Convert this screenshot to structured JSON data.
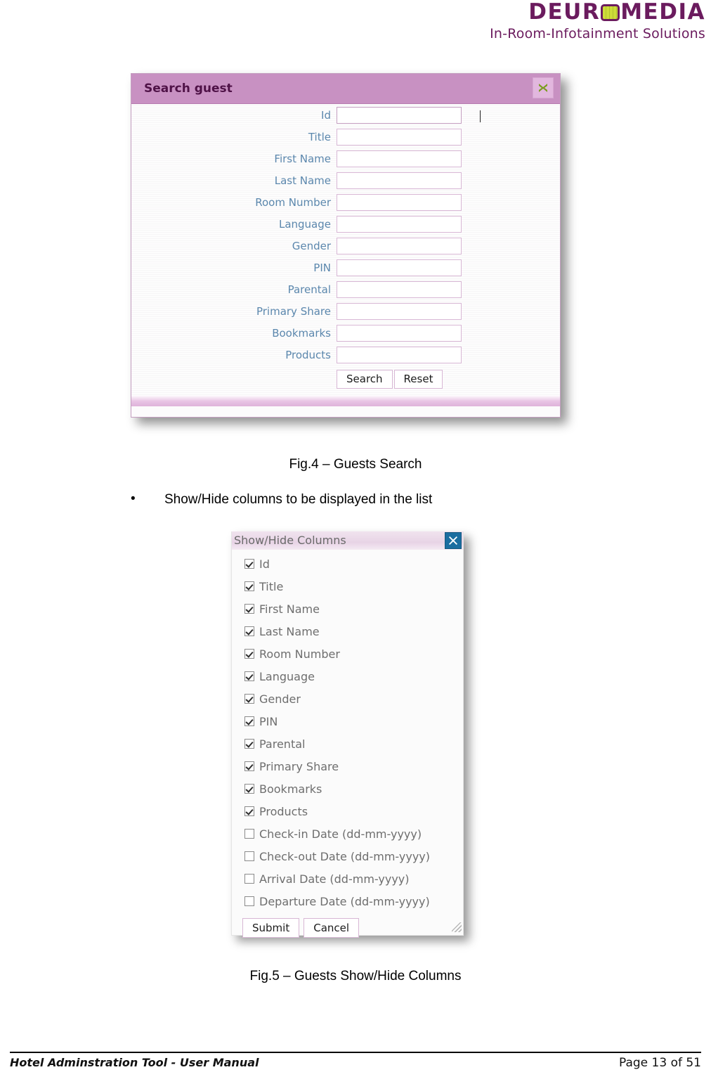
{
  "header": {
    "brand_name_before": "DEUR",
    "brand_icon": "grid-square-icon",
    "brand_name_after": "MEDIA",
    "tagline": "In-Room-Infotainment Solutions",
    "brand_color": "#6b1b5e",
    "icon_color": "#cddc39"
  },
  "search_dialog": {
    "title": "Search guest",
    "close_icon": "close-x-icon",
    "close_color": "#7a9c1d",
    "titlebar_color": "#c891c2",
    "fields": [
      {
        "label": "Id",
        "value": "",
        "focused": true
      },
      {
        "label": "Title",
        "value": "",
        "focused": false
      },
      {
        "label": "First Name",
        "value": "",
        "focused": false
      },
      {
        "label": "Last Name",
        "value": "",
        "focused": false
      },
      {
        "label": "Room Number",
        "value": "",
        "focused": false
      },
      {
        "label": "Language",
        "value": "",
        "focused": false
      },
      {
        "label": "Gender",
        "value": "",
        "focused": false
      },
      {
        "label": "PIN",
        "value": "",
        "focused": false
      },
      {
        "label": "Parental",
        "value": "",
        "focused": false
      },
      {
        "label": "Primary Share",
        "value": "",
        "focused": false
      },
      {
        "label": "Bookmarks",
        "value": "",
        "focused": false
      },
      {
        "label": "Products",
        "value": "",
        "focused": false
      }
    ],
    "search_button": "Search",
    "reset_button": "Reset"
  },
  "fig4_caption": "Fig.4 – Guests Search",
  "bullet_text": "Show/Hide columns to be displayed in the list",
  "bullet_marker": "•",
  "showhide_dialog": {
    "title": "Show/Hide Columns",
    "close_icon": "close-x-icon",
    "close_color": "#1b6ea0",
    "columns": [
      {
        "label": "Id",
        "checked": true
      },
      {
        "label": "Title",
        "checked": true
      },
      {
        "label": "First Name",
        "checked": true
      },
      {
        "label": "Last Name",
        "checked": true
      },
      {
        "label": "Room Number",
        "checked": true
      },
      {
        "label": "Language",
        "checked": true
      },
      {
        "label": "Gender",
        "checked": true
      },
      {
        "label": "PIN",
        "checked": true
      },
      {
        "label": "Parental",
        "checked": true
      },
      {
        "label": "Primary Share",
        "checked": true
      },
      {
        "label": "Bookmarks",
        "checked": true
      },
      {
        "label": "Products",
        "checked": true
      },
      {
        "label": "Check-in Date (dd-mm-yyyy)",
        "checked": false
      },
      {
        "label": "Check-out Date (dd-mm-yyyy)",
        "checked": false
      },
      {
        "label": "Arrival Date (dd-mm-yyyy)",
        "checked": false
      },
      {
        "label": "Departure Date (dd-mm-yyyy)",
        "checked": false
      }
    ],
    "submit_button": "Submit",
    "cancel_button": "Cancel",
    "resize_grip": "resize-grip-icon"
  },
  "fig5_caption": "Fig.5 – Guests Show/Hide Columns",
  "footer": {
    "left": "Hotel Adminstration Tool - User Manual",
    "right": "Page 13 of 51"
  }
}
